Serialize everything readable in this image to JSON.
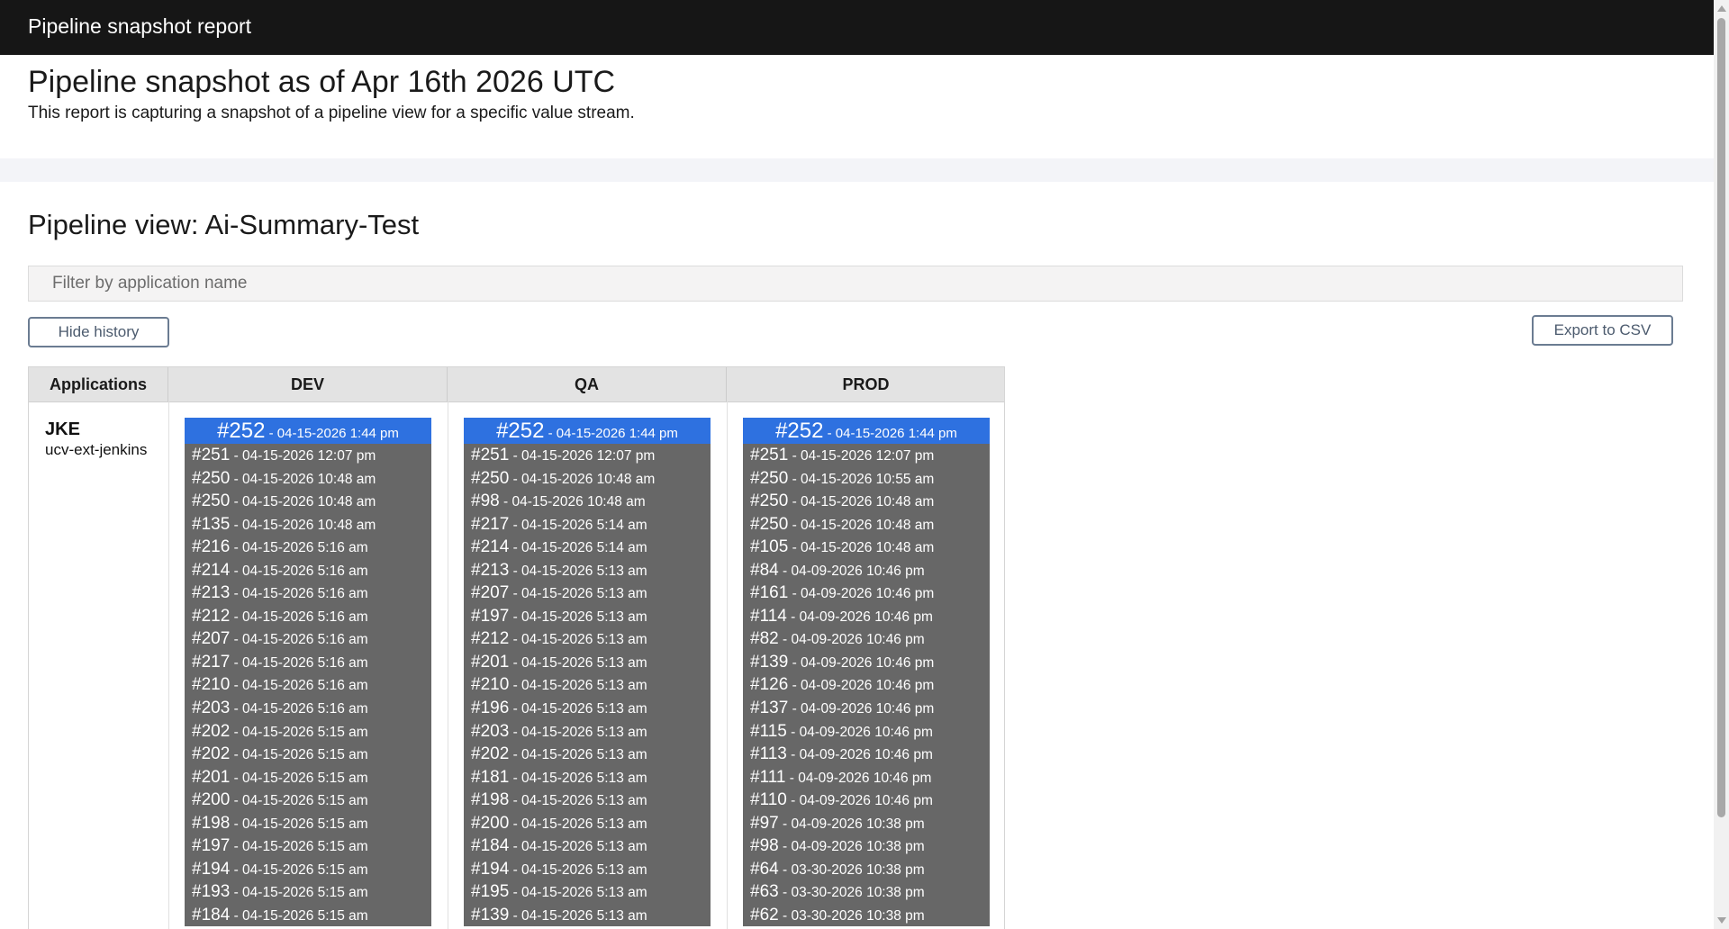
{
  "topbar": {
    "title": "Pipeline snapshot report"
  },
  "report": {
    "heading": "Pipeline snapshot as of Apr 16th 2026 UTC",
    "description": "This report is capturing a snapshot of a pipeline view for a specific value stream."
  },
  "pipeline": {
    "title": "Pipeline view: Ai-Summary-Test",
    "filter_placeholder": "Filter by application name",
    "hide_history_label": "Hide history",
    "export_label": "Export to CSV"
  },
  "table": {
    "headers": [
      "Applications",
      "DEV",
      "QA",
      "PROD"
    ],
    "application": {
      "name": "JKE",
      "subtitle": "ucv-ext-jenkins"
    },
    "environments": {
      "dev": {
        "current": {
          "num": "#252",
          "meta": " - 04-15-2026 1:44 pm"
        },
        "history": [
          {
            "num": "#251",
            "meta": " - 04-15-2026 12:07 pm"
          },
          {
            "num": "#250",
            "meta": " - 04-15-2026 10:48 am"
          },
          {
            "num": "#250",
            "meta": " - 04-15-2026 10:48 am"
          },
          {
            "num": "#135",
            "meta": " - 04-15-2026 10:48 am"
          },
          {
            "num": "#216",
            "meta": " - 04-15-2026 5:16 am"
          },
          {
            "num": "#214",
            "meta": " - 04-15-2026 5:16 am"
          },
          {
            "num": "#213",
            "meta": " - 04-15-2026 5:16 am"
          },
          {
            "num": "#212",
            "meta": " - 04-15-2026 5:16 am"
          },
          {
            "num": "#207",
            "meta": " - 04-15-2026 5:16 am"
          },
          {
            "num": "#217",
            "meta": " - 04-15-2026 5:16 am"
          },
          {
            "num": "#210",
            "meta": " - 04-15-2026 5:16 am"
          },
          {
            "num": "#203",
            "meta": " - 04-15-2026 5:16 am"
          },
          {
            "num": "#202",
            "meta": " - 04-15-2026 5:15 am"
          },
          {
            "num": "#202",
            "meta": " - 04-15-2026 5:15 am"
          },
          {
            "num": "#201",
            "meta": " - 04-15-2026 5:15 am"
          },
          {
            "num": "#200",
            "meta": " - 04-15-2026 5:15 am"
          },
          {
            "num": "#198",
            "meta": " - 04-15-2026 5:15 am"
          },
          {
            "num": "#197",
            "meta": " - 04-15-2026 5:15 am"
          },
          {
            "num": "#194",
            "meta": " - 04-15-2026 5:15 am"
          },
          {
            "num": "#193",
            "meta": " - 04-15-2026 5:15 am"
          },
          {
            "num": "#184",
            "meta": " - 04-15-2026 5:15 am"
          }
        ]
      },
      "qa": {
        "current": {
          "num": "#252",
          "meta": " - 04-15-2026 1:44 pm"
        },
        "history": [
          {
            "num": "#251",
            "meta": " - 04-15-2026 12:07 pm"
          },
          {
            "num": "#250",
            "meta": " - 04-15-2026 10:48 am"
          },
          {
            "num": "#98",
            "meta": " - 04-15-2026 10:48 am"
          },
          {
            "num": "#217",
            "meta": " - 04-15-2026 5:14 am"
          },
          {
            "num": "#214",
            "meta": " - 04-15-2026 5:14 am"
          },
          {
            "num": "#213",
            "meta": " - 04-15-2026 5:13 am"
          },
          {
            "num": "#207",
            "meta": " - 04-15-2026 5:13 am"
          },
          {
            "num": "#197",
            "meta": " - 04-15-2026 5:13 am"
          },
          {
            "num": "#212",
            "meta": " - 04-15-2026 5:13 am"
          },
          {
            "num": "#201",
            "meta": " - 04-15-2026 5:13 am"
          },
          {
            "num": "#210",
            "meta": " - 04-15-2026 5:13 am"
          },
          {
            "num": "#196",
            "meta": " - 04-15-2026 5:13 am"
          },
          {
            "num": "#203",
            "meta": " - 04-15-2026 5:13 am"
          },
          {
            "num": "#202",
            "meta": " - 04-15-2026 5:13 am"
          },
          {
            "num": "#181",
            "meta": " - 04-15-2026 5:13 am"
          },
          {
            "num": "#198",
            "meta": " - 04-15-2026 5:13 am"
          },
          {
            "num": "#200",
            "meta": " - 04-15-2026 5:13 am"
          },
          {
            "num": "#184",
            "meta": " - 04-15-2026 5:13 am"
          },
          {
            "num": "#194",
            "meta": " - 04-15-2026 5:13 am"
          },
          {
            "num": "#195",
            "meta": " - 04-15-2026 5:13 am"
          },
          {
            "num": "#139",
            "meta": " - 04-15-2026 5:13 am"
          }
        ]
      },
      "prod": {
        "current": {
          "num": "#252",
          "meta": " - 04-15-2026 1:44 pm"
        },
        "history": [
          {
            "num": "#251",
            "meta": " - 04-15-2026 12:07 pm"
          },
          {
            "num": "#250",
            "meta": " - 04-15-2026 10:55 am"
          },
          {
            "num": "#250",
            "meta": " - 04-15-2026 10:48 am"
          },
          {
            "num": "#250",
            "meta": " - 04-15-2026 10:48 am"
          },
          {
            "num": "#105",
            "meta": " - 04-15-2026 10:48 am"
          },
          {
            "num": "#84",
            "meta": " - 04-09-2026 10:46 pm"
          },
          {
            "num": "#161",
            "meta": " - 04-09-2026 10:46 pm"
          },
          {
            "num": "#114",
            "meta": " - 04-09-2026 10:46 pm"
          },
          {
            "num": "#82",
            "meta": " - 04-09-2026 10:46 pm"
          },
          {
            "num": "#139",
            "meta": " - 04-09-2026 10:46 pm"
          },
          {
            "num": "#126",
            "meta": " - 04-09-2026 10:46 pm"
          },
          {
            "num": "#137",
            "meta": " - 04-09-2026 10:46 pm"
          },
          {
            "num": "#115",
            "meta": " - 04-09-2026 10:46 pm"
          },
          {
            "num": "#113",
            "meta": " - 04-09-2026 10:46 pm"
          },
          {
            "num": "#111",
            "meta": " - 04-09-2026 10:46 pm"
          },
          {
            "num": "#110",
            "meta": " - 04-09-2026 10:46 pm"
          },
          {
            "num": "#97",
            "meta": " - 04-09-2026 10:38 pm"
          },
          {
            "num": "#98",
            "meta": " - 04-09-2026 10:38 pm"
          },
          {
            "num": "#64",
            "meta": " - 03-30-2026 10:38 pm"
          },
          {
            "num": "#63",
            "meta": " - 03-30-2026 10:38 pm"
          },
          {
            "num": "#62",
            "meta": " - 03-30-2026 10:38 pm"
          }
        ]
      }
    }
  },
  "colors": {
    "topbar_bg": "#161616",
    "current_build_bg": "#2e71e0",
    "history_bg": "#676767",
    "header_bg": "#e3e3e3"
  }
}
